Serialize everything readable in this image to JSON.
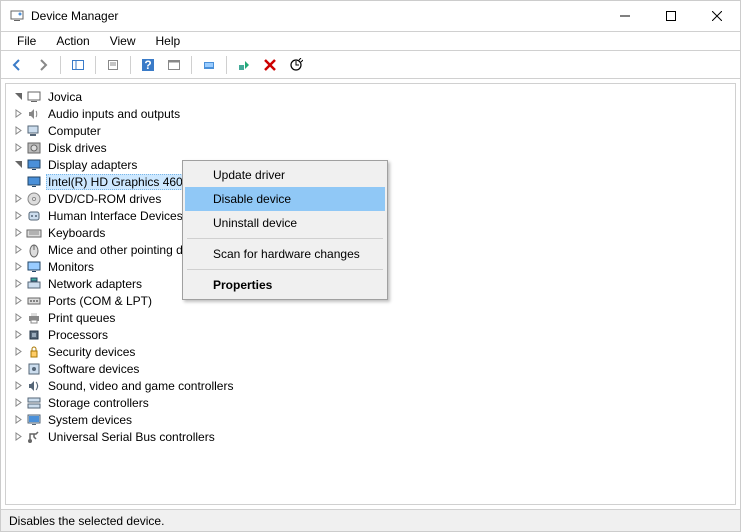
{
  "window": {
    "title": "Device Manager"
  },
  "menu": {
    "file": "File",
    "action": "Action",
    "view": "View",
    "help": "Help"
  },
  "tree": {
    "root": "Jovica",
    "nodes": [
      {
        "label": "Audio inputs and outputs"
      },
      {
        "label": "Computer"
      },
      {
        "label": "Disk drives"
      },
      {
        "label": "Display adapters",
        "expanded": true,
        "child": "Intel(R) HD Graphics 4600",
        "childSelected": true
      },
      {
        "label": "DVD/CD-ROM drives"
      },
      {
        "label": "Human Interface Devices"
      },
      {
        "label": "Keyboards"
      },
      {
        "label": "Mice and other pointing devices"
      },
      {
        "label": "Monitors"
      },
      {
        "label": "Network adapters"
      },
      {
        "label": "Ports (COM & LPT)"
      },
      {
        "label": "Print queues"
      },
      {
        "label": "Processors"
      },
      {
        "label": "Security devices"
      },
      {
        "label": "Software devices"
      },
      {
        "label": "Sound, video and game controllers"
      },
      {
        "label": "Storage controllers"
      },
      {
        "label": "System devices"
      },
      {
        "label": "Universal Serial Bus controllers"
      }
    ]
  },
  "contextMenu": {
    "updateDriver": "Update driver",
    "disableDevice": "Disable device",
    "uninstallDevice": "Uninstall device",
    "scanHardware": "Scan for hardware changes",
    "properties": "Properties"
  },
  "statusbar": {
    "text": "Disables the selected device."
  },
  "icons": {
    "categories": {
      "Audio inputs and outputs": "speaker",
      "Computer": "computer",
      "Disk drives": "disk",
      "Display adapters": "display",
      "DVD/CD-ROM drives": "dvd",
      "Human Interface Devices": "hid",
      "Keyboards": "keyboard",
      "Mice and other pointing devices": "mouse",
      "Monitors": "monitor",
      "Network adapters": "network",
      "Ports (COM & LPT)": "port",
      "Print queues": "printer",
      "Processors": "processor",
      "Security devices": "security",
      "Software devices": "software",
      "Sound, video and game controllers": "sound",
      "Storage controllers": "storage",
      "System devices": "system",
      "Universal Serial Bus controllers": "usb"
    }
  }
}
